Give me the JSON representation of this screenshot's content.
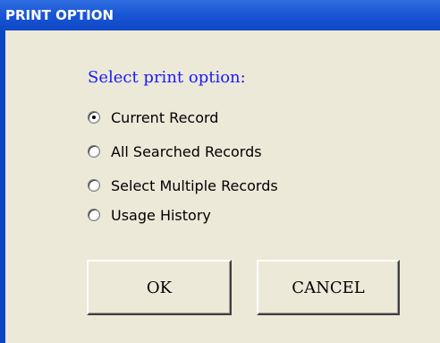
{
  "window": {
    "title": "PRINT OPTION"
  },
  "prompt": "Select print option:",
  "options": [
    {
      "label": "Current Record",
      "selected": true
    },
    {
      "label": "All Searched Records",
      "selected": false
    },
    {
      "label": "Select Multiple Records",
      "selected": false
    },
    {
      "label": "Usage History",
      "selected": false
    }
  ],
  "buttons": {
    "ok": "OK",
    "cancel": "CANCEL"
  },
  "colors": {
    "title_bar": "#1a57d6",
    "prompt_text": "#1a1aff",
    "dialog_bg": "#ece9d8"
  }
}
